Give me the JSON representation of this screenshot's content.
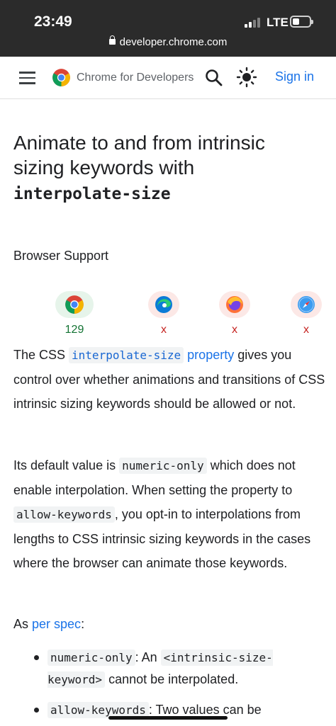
{
  "status_bar": {
    "time": "23:49",
    "network": "LTE",
    "url": "developer.chrome.com"
  },
  "header": {
    "brand": "Chrome for Developers",
    "sign_in": "Sign in"
  },
  "article": {
    "title_line1": "Animate to and from intrinsic",
    "title_line2": "sizing keywords with",
    "title_code": "interpolate-size",
    "browser_support_label": "Browser Support",
    "browsers": [
      {
        "name": "chrome",
        "value": "129",
        "supported": true
      },
      {
        "name": "edge",
        "value": "x",
        "supported": false
      },
      {
        "name": "firefox",
        "value": "x",
        "supported": false
      },
      {
        "name": "safari",
        "value": "x",
        "supported": false
      }
    ],
    "p1": {
      "prefix": "The CSS ",
      "code": "interpolate-size",
      "link": "property",
      "suffix_line1": " gives you",
      "rest": "control over whether animations and transitions of CSS intrinsic sizing keywords should be allowed or not."
    },
    "p2": {
      "prefix": "Its default value is ",
      "code1": "numeric-only",
      "mid": " which does not enable interpolation. When setting the property to ",
      "code2": "allow-keywords",
      "suffix": ", you opt-in to interpolations from lengths to CSS intrinsic sizing keywords in the cases where the browser can animate those keywords."
    },
    "p3": {
      "prefix": "As ",
      "link": "per spec",
      "suffix": ":"
    },
    "bullets": [
      {
        "code": "numeric-only",
        "sep": ": An ",
        "code2": "<intrinsic-size-keyword>",
        "text": " cannot be interpolated."
      },
      {
        "code": "allow-keywords",
        "sep": ": Two values can be",
        "code2": "",
        "text": ""
      }
    ]
  },
  "colors": {
    "link": "#1a73e8",
    "supported": "#137333",
    "unsupported": "#c5221f"
  }
}
